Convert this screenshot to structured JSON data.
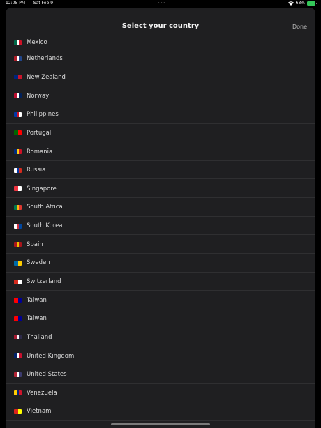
{
  "status_bar": {
    "time": "12:05 PM",
    "date": "Sat Feb 9",
    "battery_percent": "63%",
    "battery_level": 0.63,
    "accent": "#34c759"
  },
  "sheet": {
    "title": "Select your country",
    "done_label": "Done"
  },
  "countries": [
    {
      "name": "Mexico",
      "flag": "mexico-flag-icon",
      "colors": [
        "#006847",
        "#ffffff",
        "#ce1126"
      ]
    },
    {
      "name": "Netherlands",
      "flag": "netherlands-flag-icon",
      "colors": [
        "#ae1c28",
        "#ffffff",
        "#21468b"
      ]
    },
    {
      "name": "New Zealand",
      "flag": "new-zealand-flag-icon",
      "colors": [
        "#00247d",
        "#cc142b"
      ]
    },
    {
      "name": "Norway",
      "flag": "norway-flag-icon",
      "colors": [
        "#ba0c2f",
        "#ffffff",
        "#00205b"
      ]
    },
    {
      "name": "Philippines",
      "flag": "philippines-flag-icon",
      "colors": [
        "#0038a8",
        "#ce1126",
        "#ffffff"
      ]
    },
    {
      "name": "Portugal",
      "flag": "portugal-flag-icon",
      "colors": [
        "#006600",
        "#ff0000"
      ]
    },
    {
      "name": "Romania",
      "flag": "romania-flag-icon",
      "colors": [
        "#002b7f",
        "#fcd116",
        "#ce1126"
      ]
    },
    {
      "name": "Russia",
      "flag": "russia-flag-icon",
      "colors": [
        "#ffffff",
        "#0039a6",
        "#d52b1e"
      ]
    },
    {
      "name": "Singapore",
      "flag": "singapore-flag-icon",
      "colors": [
        "#ef3340",
        "#ffffff"
      ]
    },
    {
      "name": "South Africa",
      "flag": "south-africa-flag-icon",
      "colors": [
        "#007a4d",
        "#ffb612",
        "#de3831"
      ]
    },
    {
      "name": "South Korea",
      "flag": "south-korea-flag-icon",
      "colors": [
        "#ffffff",
        "#cd2e3a",
        "#0047a0"
      ]
    },
    {
      "name": "Spain",
      "flag": "spain-flag-icon",
      "colors": [
        "#aa151b",
        "#f1bf00",
        "#aa151b"
      ]
    },
    {
      "name": "Sweden",
      "flag": "sweden-flag-icon",
      "colors": [
        "#006aa7",
        "#fecc00"
      ]
    },
    {
      "name": "Switzerland",
      "flag": "switzerland-flag-icon",
      "colors": [
        "#d52b1e",
        "#ffffff"
      ]
    },
    {
      "name": "Taiwan",
      "flag": "taiwan-flag-icon",
      "colors": [
        "#fe0000",
        "#000095"
      ]
    },
    {
      "name": "Taiwan",
      "flag": "taiwan-flag-icon",
      "colors": [
        "#fe0000",
        "#000095"
      ]
    },
    {
      "name": "Thailand",
      "flag": "thailand-flag-icon",
      "colors": [
        "#a51931",
        "#f4f5f8",
        "#2d2a4a"
      ]
    },
    {
      "name": "United Kingdom",
      "flag": "united-kingdom-flag-icon",
      "colors": [
        "#012169",
        "#ffffff",
        "#c8102e"
      ]
    },
    {
      "name": "United States",
      "flag": "united-states-flag-icon",
      "colors": [
        "#b22234",
        "#ffffff",
        "#3c3b6e"
      ]
    },
    {
      "name": "Venezuela",
      "flag": "venezuela-flag-icon",
      "colors": [
        "#ffcc00",
        "#00247d",
        "#cf142b"
      ]
    },
    {
      "name": "Vietnam",
      "flag": "vietnam-flag-icon",
      "colors": [
        "#da251d",
        "#ffff00"
      ]
    }
  ]
}
